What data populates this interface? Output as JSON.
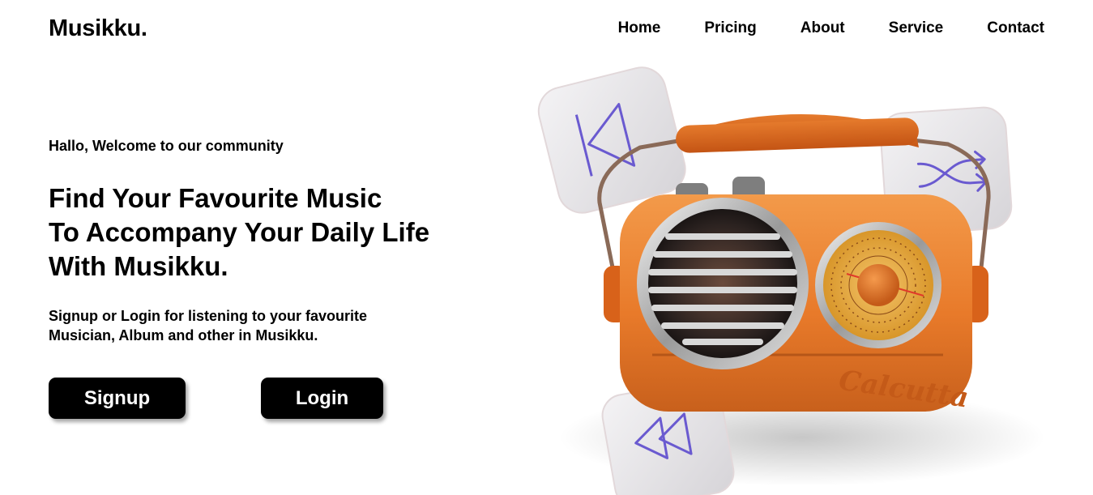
{
  "brand": {
    "logo": "Musikku."
  },
  "nav": {
    "items": [
      "Home",
      "Pricing",
      "About",
      "Service",
      "Contact"
    ]
  },
  "hero": {
    "welcome": "Hallo, Welcome to our community",
    "headline": [
      "Find Your Favourite Music",
      "To Accompany Your Daily Life",
      "With Musikku."
    ],
    "subtext": "Signup or Login for listening to your favourite Musician, Album and other in Musikku.",
    "signup_label": "Signup",
    "login_label": "Login"
  },
  "illustration": {
    "radio_brand": "Calcutta",
    "icons": [
      "previous-track-icon",
      "shuffle-icon",
      "rewind-icon"
    ],
    "colors": {
      "radio_body": "#ea7a25",
      "radio_handle": "#d8621a",
      "icon_tile": "#e9e7ea",
      "icon_stroke": "#6a5ad0"
    }
  }
}
